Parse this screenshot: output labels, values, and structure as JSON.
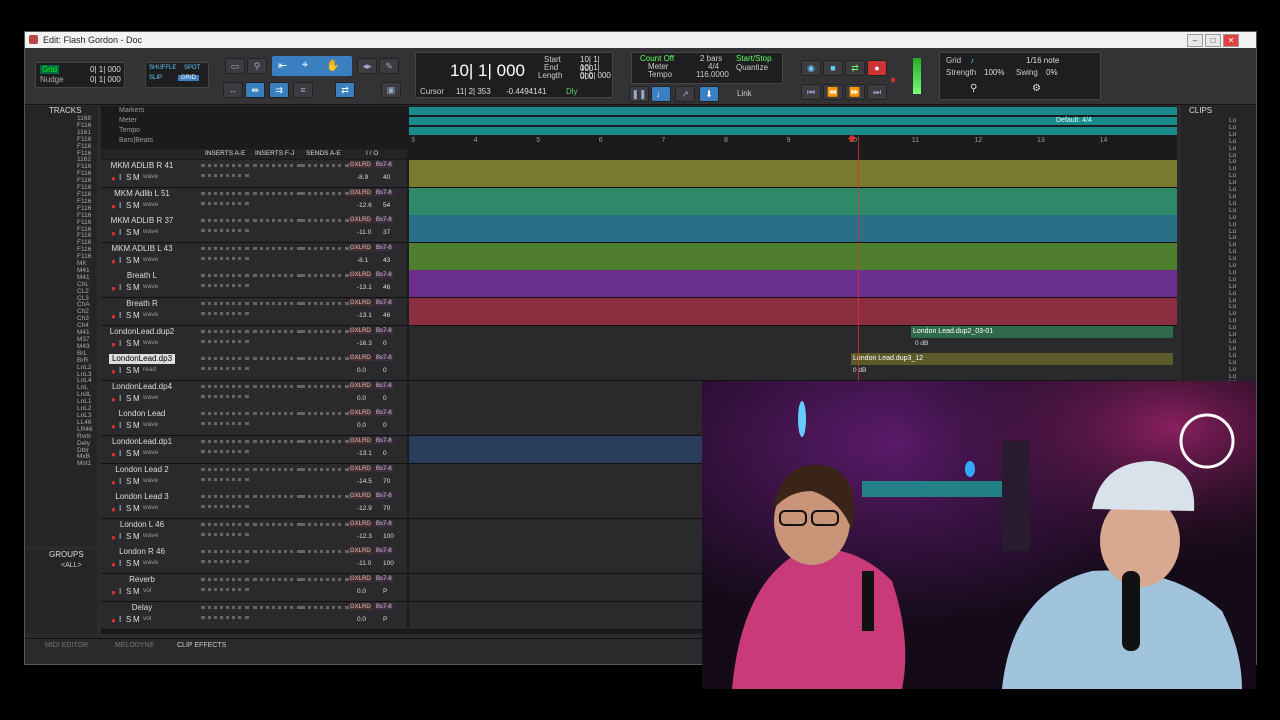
{
  "window": {
    "title": "Edit: Flash Gordon - Doc"
  },
  "toolbar": {
    "grid_label": "Grid",
    "nudge_label": "Nudge",
    "grid_value": "0| 1| 000",
    "nudge_value": "0| 1| 000",
    "modes": [
      "SHUFFLE",
      "SPOT",
      "SLIP",
      "GRID"
    ],
    "main_counter": "10| 1| 000",
    "start_label": "Start",
    "end_label": "End",
    "length_label": "Length",
    "start_value": "10| 1| 000",
    "end_value": "10| 1| 000",
    "length_value": "0| 0| 000",
    "cursor_label": "Cursor",
    "cursor_value": "11| 2| 353",
    "cursor_db": "-0.4494141",
    "dly_label": "Dly",
    "count_off_label": "Count Off",
    "count_off_value": "2 bars",
    "meter_label": "Meter",
    "meter_value": "4/4",
    "tempo_label": "Tempo",
    "tempo_value": "116.0000",
    "start_stop_label": "Start/Stop",
    "quantize_label": "Quantize",
    "link_label": "Link",
    "grid_right_label": "Grid",
    "grid_right_value": "1/16 note",
    "strength_label": "Strength",
    "strength_value": "100%",
    "swing_label": "Swing",
    "swing_value": "0%"
  },
  "tracks_panel": {
    "title": "TRACKS",
    "items": [
      "1168",
      "F116",
      "1161",
      "F116",
      "F116",
      "F116",
      "1162",
      "F116",
      "F116",
      "F116",
      "F116",
      "F116",
      "F116",
      "F116",
      "F116",
      "F116",
      "F116",
      "F116",
      "F116",
      "F116",
      "F116",
      "MK",
      "M41",
      "M41",
      "ChL",
      "CL2",
      "CL3",
      "ChA",
      "Ch2",
      "Ch3",
      "Ch4",
      "M41",
      "M37",
      "M43",
      "BrL",
      "BrR",
      "LnL2",
      "LnL3",
      "LnL4",
      "LnL",
      "LndL",
      "LnL1",
      "LnL2",
      "LnL3",
      "LL46",
      "LR46",
      "Rvrb",
      "Dely",
      "Dblr",
      "MxB",
      "Mst1"
    ]
  },
  "groups_panel": {
    "title": "GROUPS",
    "all_label": "<ALL>"
  },
  "rulers": [
    {
      "label": "Markers"
    },
    {
      "label": "Meter"
    },
    {
      "label": "Tempo"
    },
    {
      "label": "Bars|Beats"
    }
  ],
  "default_meter": "Default: 4/4",
  "bar_numbers": [
    "3",
    "4",
    "5",
    "6",
    "7",
    "8",
    "9",
    "10",
    "11",
    "12",
    "13",
    "14"
  ],
  "column_headers": {
    "inserts_ae": "INSERTS A-E",
    "inserts_fj": "INSERTS F-J",
    "sends_ae": "SENDS A-E",
    "io": "I / O"
  },
  "tracks": [
    {
      "name": "MKM ADLIB R 41",
      "db": "-8.9",
      "pan": "40",
      "color": "#7a7a2e",
      "mode": "wave",
      "sel": false
    },
    {
      "name": "MKM Adlib L 51",
      "db": "-12.6",
      "pan": "54",
      "color": "#2f8a6a",
      "mode": "wave",
      "sel": false
    },
    {
      "name": "MKM ADLIB R 37",
      "db": "-11.0",
      "pan": "37",
      "color": "#2a6f86",
      "mode": "wave",
      "sel": false
    },
    {
      "name": "MKM ADLIB L 43",
      "db": "-8.1",
      "pan": "43",
      "color": "#4f7f2e",
      "mode": "wave",
      "sel": false
    },
    {
      "name": "Breath L",
      "db": "-13.1",
      "pan": "46",
      "color": "#6a2f8a",
      "mode": "wave",
      "sel": false
    },
    {
      "name": "Breath R",
      "db": "-13.1",
      "pan": "46",
      "color": "#8a2f40",
      "mode": "wave",
      "sel": false
    },
    {
      "name": "LondonLead.dup2",
      "db": "-16.3",
      "pan": "0",
      "color": "#2a2a2c",
      "mode": "wave",
      "sel": false
    },
    {
      "name": "LondonLead.dp3",
      "db": "0.0",
      "pan": "0",
      "color": "#2a2a2c",
      "mode": "read",
      "sel": true
    },
    {
      "name": "LondonLead.dp4",
      "db": "0.0",
      "pan": "0",
      "color": "#2a2a2c",
      "mode": "wave",
      "sel": false
    },
    {
      "name": "London Lead",
      "db": "0.0",
      "pan": "0",
      "color": "#2a2a2c",
      "mode": "wave",
      "sel": false
    },
    {
      "name": "LondonLead.dp1",
      "db": "-13.1",
      "pan": "0",
      "color": "#2a3d5c",
      "mode": "wave",
      "sel": false
    },
    {
      "name": "London Lead 2",
      "db": "-14.5",
      "pan": "70",
      "color": "#2a2a2c",
      "mode": "wave",
      "sel": false
    },
    {
      "name": "London Lead 3",
      "db": "-12.9",
      "pan": "70",
      "color": "#2a2a2c",
      "mode": "wave",
      "sel": false
    },
    {
      "name": "London L 46",
      "db": "-12.3",
      "pan": "100",
      "color": "#2a2a2c",
      "mode": "wave",
      "sel": false
    },
    {
      "name": "London R 46",
      "db": "-11.0",
      "pan": "100",
      "color": "#2a2a2c",
      "mode": "wave",
      "sel": false
    },
    {
      "name": "Reverb",
      "db": "0.0",
      "pan": "P",
      "color": "#2a2a2c",
      "mode": "vol",
      "sel": false
    },
    {
      "name": "Delay",
      "db": "0.0",
      "pan": "P",
      "color": "#2a2a2c",
      "mode": "vol",
      "sel": false
    }
  ],
  "io_labels": {
    "in": "GXLRD",
    "out": "Bs7-8"
  },
  "clips": [
    {
      "name": "London Lead.dup2_03-01",
      "gain": "0 dB"
    },
    {
      "name": "London Lead.dup3_12",
      "gain": "0 dB"
    }
  ],
  "clips_panel": {
    "title": "CLIPS",
    "item_label": "Lo"
  },
  "bottom_tabs": [
    "MIDI EDITOR",
    "MELODYNE",
    "CLIP EFFECTS"
  ],
  "colors": {
    "accent": "#3a7fc0",
    "timeline": "#1b8a8a",
    "record": "#d93030"
  }
}
